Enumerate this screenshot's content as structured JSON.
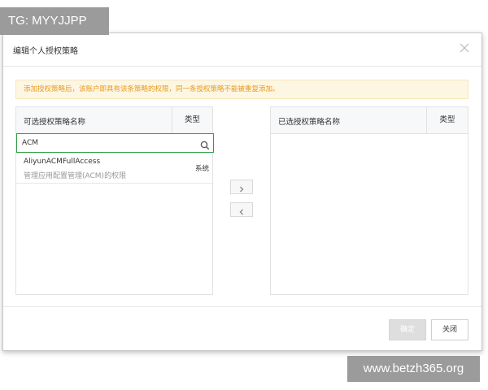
{
  "watermark": {
    "top": "TG: MYYJJPP",
    "bottom": "www.betzh365.org"
  },
  "dialog": {
    "title": "编辑个人授权策略",
    "close_icon": "close-icon",
    "notice": "添加授权策略后，该账户即具有该条策略的权限，同一条授权策略不能被重复添加。",
    "notice_color": "#e89b1c"
  },
  "available": {
    "header_name": "可选授权策略名称",
    "header_type": "类型",
    "search_value": "ACM",
    "search_icon": "search-icon",
    "items": [
      {
        "name": "AliyunACMFullAccess",
        "description": "管理应用配置管理(ACM)的权限",
        "type": "系统"
      }
    ]
  },
  "selected": {
    "header_name": "已选授权策略名称",
    "header_type": "类型",
    "items": []
  },
  "transfer": {
    "add_icon": "chevron-right-icon",
    "remove_icon": "chevron-left-icon"
  },
  "footer": {
    "confirm_label": "确定",
    "close_label": "关闭"
  }
}
